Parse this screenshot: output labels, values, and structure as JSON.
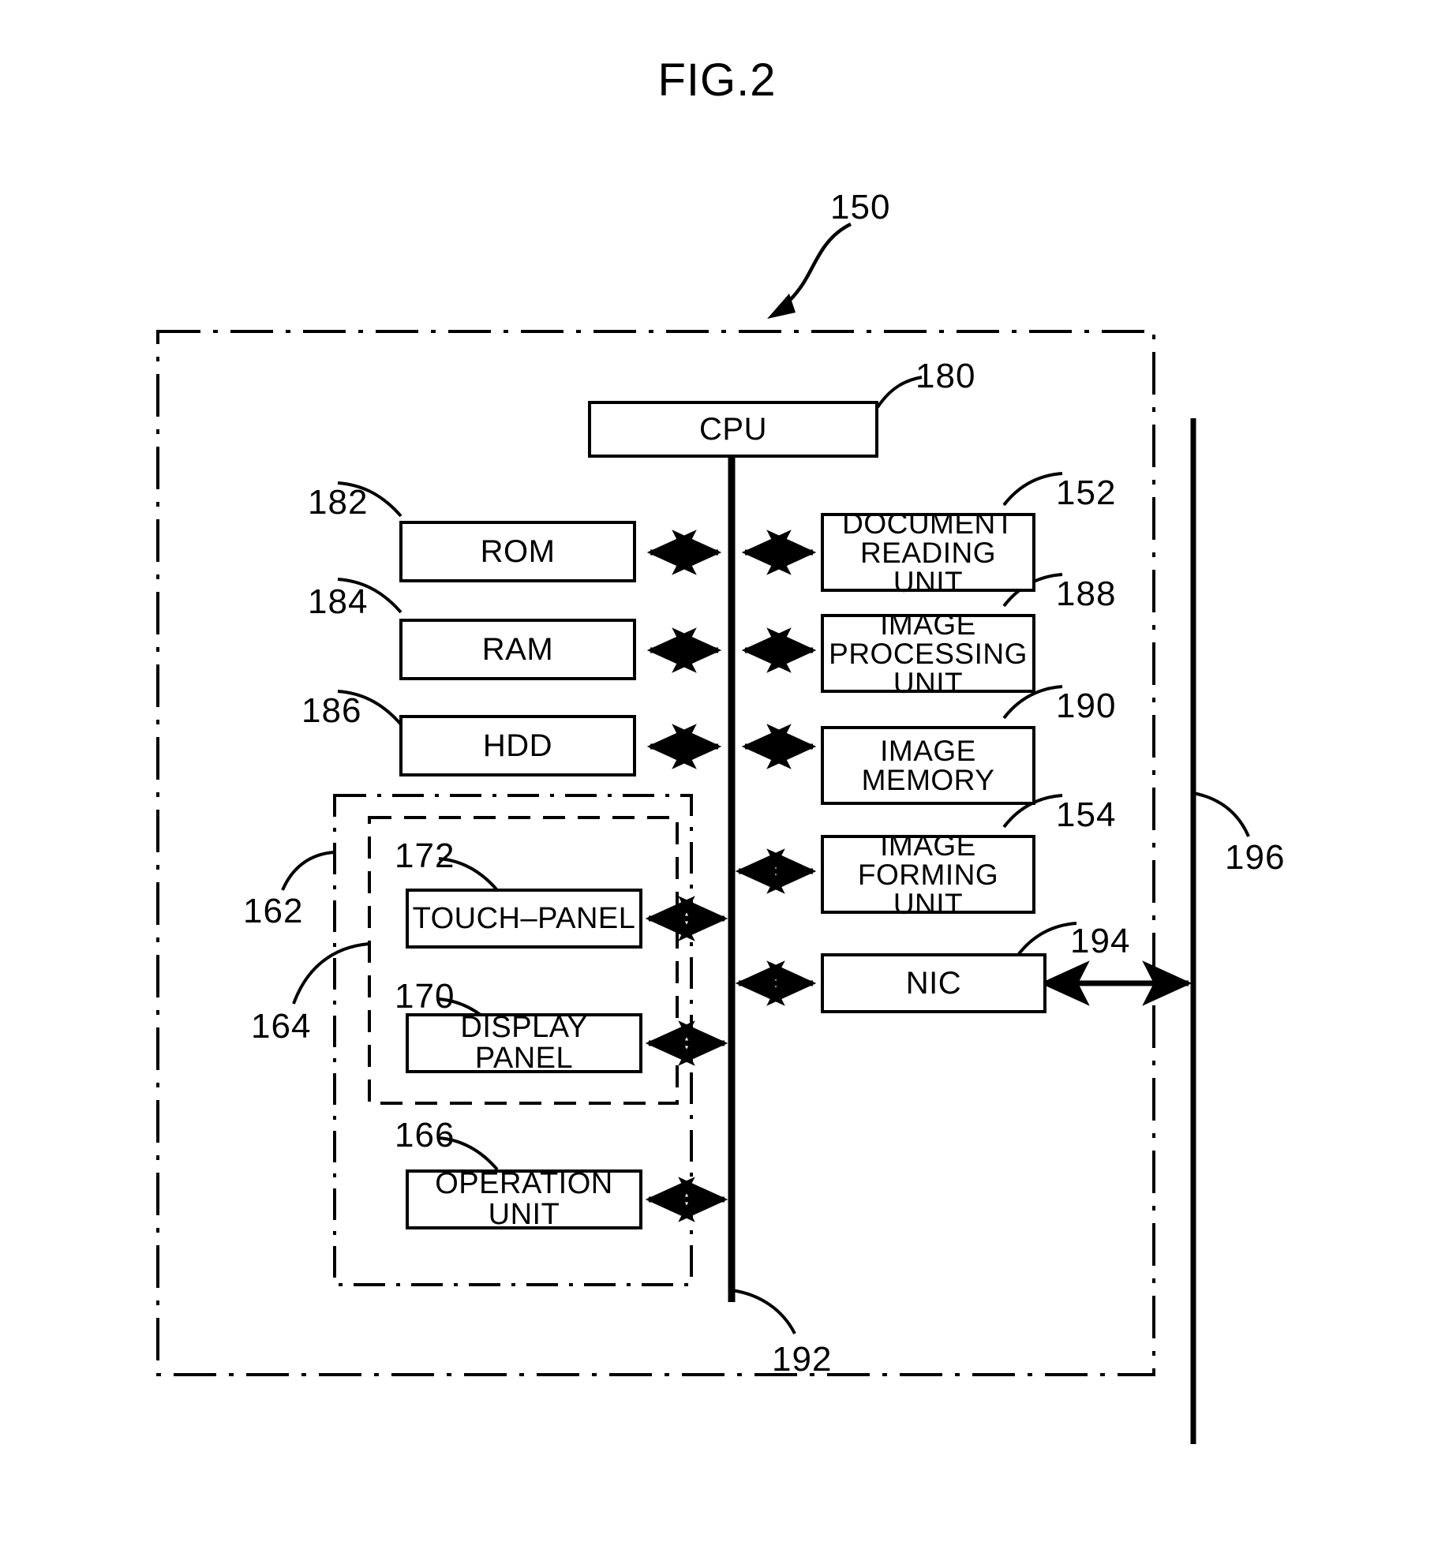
{
  "figure": {
    "title": "FIG.2",
    "system_ref": "150",
    "bus_ref": "192",
    "external_line_ref": "196",
    "panel_group_ref": "162",
    "panel_inner_group_ref": "164"
  },
  "blocks": [
    {
      "id": "cpu",
      "label": "CPU",
      "lines": [
        "CPU"
      ],
      "ref": "180"
    },
    {
      "id": "rom",
      "label": "ROM",
      "lines": [
        "ROM"
      ],
      "ref": "182"
    },
    {
      "id": "ram",
      "label": "RAM",
      "lines": [
        "RAM"
      ],
      "ref": "184"
    },
    {
      "id": "hdd",
      "label": "HDD",
      "lines": [
        "HDD"
      ],
      "ref": "186"
    },
    {
      "id": "document-reading-unit",
      "label": "DOCUMENT READING UNIT",
      "lines": [
        "DOCUMENT",
        "READING UNIT"
      ],
      "ref": "152"
    },
    {
      "id": "image-processing-unit",
      "label": "IMAGE PROCESSING UNIT",
      "lines": [
        "IMAGE",
        "PROCESSING UNIT"
      ],
      "ref": "188"
    },
    {
      "id": "image-memory",
      "label": "IMAGE MEMORY",
      "lines": [
        "IMAGE",
        "MEMORY"
      ],
      "ref": "190"
    },
    {
      "id": "image-forming-unit",
      "label": "IMAGE FORMING UNIT",
      "lines": [
        "IMAGE",
        "FORMING UNIT"
      ],
      "ref": "154"
    },
    {
      "id": "nic",
      "label": "NIC",
      "lines": [
        "NIC"
      ],
      "ref": "194"
    },
    {
      "id": "touch-panel",
      "label": "TOUCH-PANEL",
      "lines": [
        "TOUCH–PANEL"
      ],
      "ref": "172"
    },
    {
      "id": "display-panel",
      "label": "DISPLAY PANEL",
      "lines": [
        "DISPLAY PANEL"
      ],
      "ref": "170"
    },
    {
      "id": "operation-unit",
      "label": "OPERATION UNIT",
      "lines": [
        "OPERATION UNIT"
      ],
      "ref": "166"
    }
  ],
  "colors": {
    "ink": "#000000",
    "paper": "#ffffff"
  }
}
